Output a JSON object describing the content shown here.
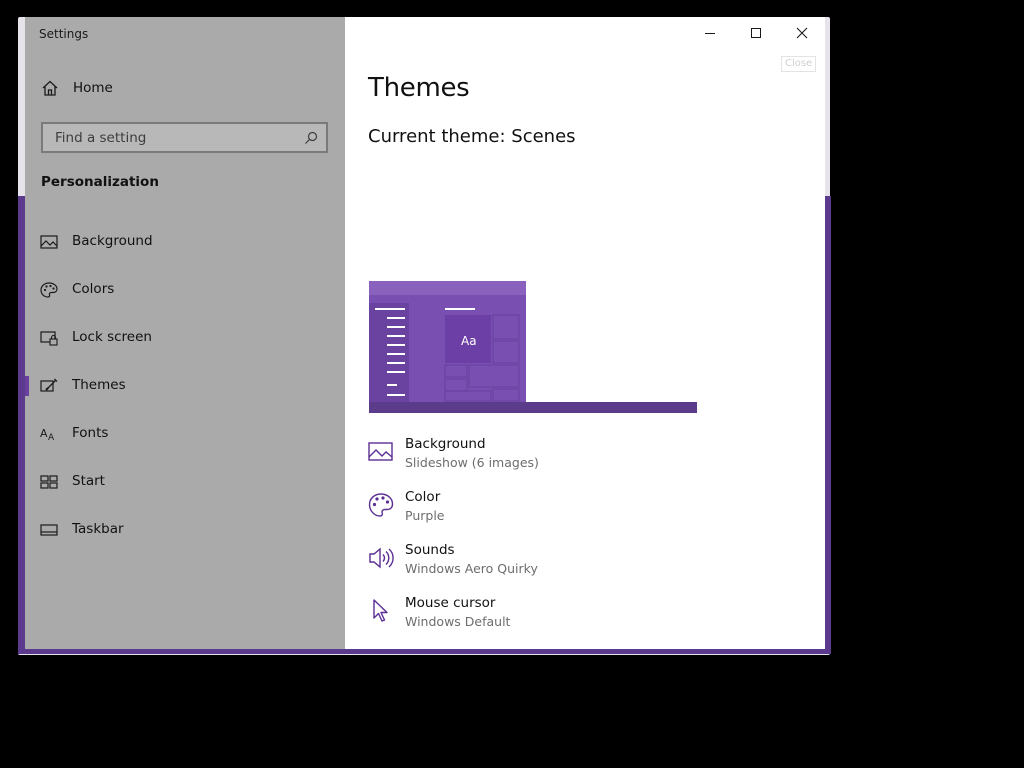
{
  "window": {
    "title": "Settings",
    "close_hint": "Close"
  },
  "sidebar": {
    "home_label": "Home",
    "search_placeholder": "Find a setting",
    "section_title": "Personalization",
    "items": [
      {
        "label": "Background",
        "icon": "picture-icon",
        "selected": false
      },
      {
        "label": "Colors",
        "icon": "palette-icon",
        "selected": false
      },
      {
        "label": "Lock screen",
        "icon": "lock-screen-icon",
        "selected": false
      },
      {
        "label": "Themes",
        "icon": "brush-icon",
        "selected": true
      },
      {
        "label": "Fonts",
        "icon": "fonts-icon",
        "selected": false
      },
      {
        "label": "Start",
        "icon": "start-icon",
        "selected": false
      },
      {
        "label": "Taskbar",
        "icon": "taskbar-icon",
        "selected": false
      }
    ]
  },
  "main": {
    "title": "Themes",
    "current_theme": "Current theme: Scenes",
    "preview_sample": "Aa",
    "options": [
      {
        "name": "Background",
        "value": "Slideshow (6 images)",
        "icon": "picture-icon"
      },
      {
        "name": "Color",
        "value": "Purple",
        "icon": "palette-icon"
      },
      {
        "name": "Sounds",
        "value": "Windows Aero Quirky",
        "icon": "speaker-icon"
      },
      {
        "name": "Mouse cursor",
        "value": "Windows Default",
        "icon": "cursor-icon"
      }
    ]
  },
  "colors": {
    "accent": "#6b3fa0",
    "frame": "#5b3a8d",
    "sidebar_bg": "#aaaaaa"
  }
}
